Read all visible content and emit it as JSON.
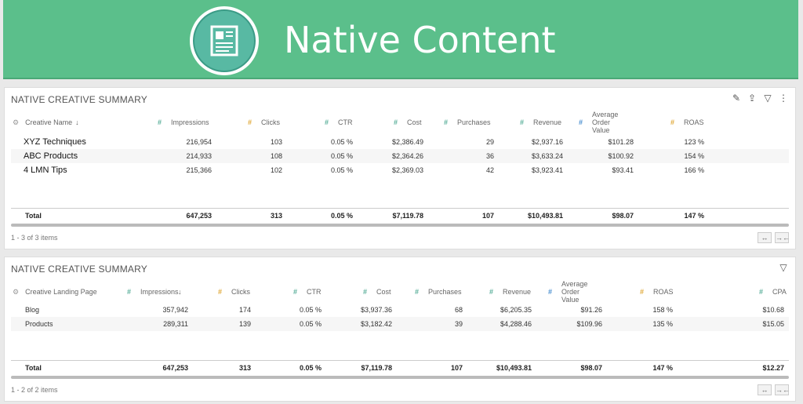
{
  "banner": {
    "title": "Native Content"
  },
  "panel1": {
    "title": "NATIVE CREATIVE SUMMARY",
    "headers": [
      "Creative Name",
      "Impressions",
      "Clicks",
      "CTR",
      "Cost",
      "Purchases",
      "Revenue",
      "Average Order Value",
      "ROAS"
    ],
    "rows": [
      [
        "XYZ Techniques",
        "216,954",
        "103",
        "0.05 %",
        "$2,386.49",
        "29",
        "$2,937.16",
        "$101.28",
        "123 %"
      ],
      [
        "ABC Products",
        "214,933",
        "108",
        "0.05 %",
        "$2,364.26",
        "36",
        "$3,633.24",
        "$100.92",
        "154 %"
      ],
      [
        "4 LMN Tips",
        "215,366",
        "102",
        "0.05 %",
        "$2,369.03",
        "42",
        "$3,923.41",
        "$93.41",
        "166 %"
      ]
    ],
    "total": [
      "Total",
      "647,253",
      "313",
      "0.05 %",
      "$7,119.78",
      "107",
      "$10,493.81",
      "$98.07",
      "147 %"
    ],
    "footer": "1 - 3 of 3 items"
  },
  "panel2": {
    "title": "NATIVE CREATIVE SUMMARY",
    "headers": [
      "Creative Landing Page",
      "Impressions",
      "Clicks",
      "CTR",
      "Cost",
      "Purchases",
      "Revenue",
      "Average Order Value",
      "ROAS",
      "CPA"
    ],
    "rows": [
      [
        "Blog",
        "357,942",
        "174",
        "0.05 %",
        "$3,937.36",
        "68",
        "$6,205.35",
        "$91.26",
        "158 %",
        "$10.68"
      ],
      [
        "Products",
        "289,311",
        "139",
        "0.05 %",
        "$3,182.42",
        "39",
        "$4,288.46",
        "$109.96",
        "135 %",
        "$15.05"
      ]
    ],
    "total": [
      "Total",
      "647,253",
      "313",
      "0.05 %",
      "$7,119.78",
      "107",
      "$10,493.81",
      "$98.07",
      "147 %",
      "$12.27"
    ],
    "footer": "1 - 2 of 2 items"
  },
  "colors": {
    "banner": "#5bbf8b",
    "hash_green": "#5aaf9a",
    "hash_yellow": "#e0a93a",
    "hash_blue": "#4a8fd0"
  }
}
